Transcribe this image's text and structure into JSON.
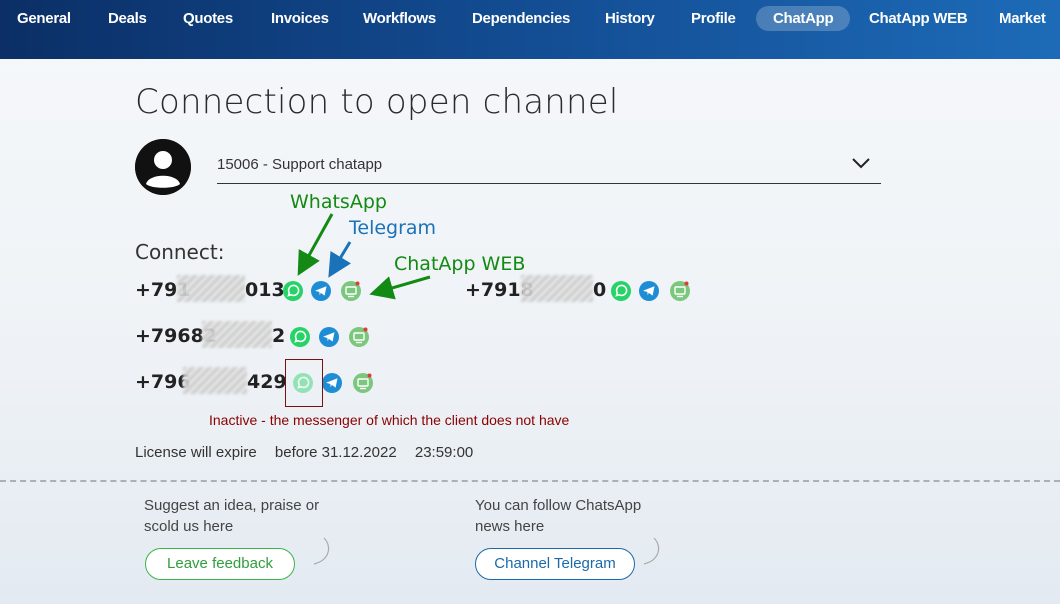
{
  "nav": {
    "tabs": [
      {
        "label": "General"
      },
      {
        "label": "Deals"
      },
      {
        "label": "Quotes"
      },
      {
        "label": "Invoices"
      },
      {
        "label": "Workflows"
      },
      {
        "label": "Dependencies"
      },
      {
        "label": "History"
      },
      {
        "label": "Profile"
      },
      {
        "label": "ChatApp",
        "active": true
      },
      {
        "label": "ChatApp WEB"
      },
      {
        "label": "Market"
      }
    ]
  },
  "page": {
    "title": "Connection to open channel",
    "channel_select": {
      "value": "15006 - Support chatapp"
    },
    "connect_label": "Connect:"
  },
  "phones": [
    {
      "prefix": "+791",
      "suffix": "013",
      "icons": [
        "whatsapp-icon",
        "telegram-icon",
        "chatapp-web-icon"
      ]
    },
    {
      "prefix": "+7918",
      "suffix": "0",
      "icons": [
        "whatsapp-icon",
        "telegram-icon",
        "chatapp-web-icon"
      ]
    },
    {
      "prefix": "+79682",
      "suffix": "2",
      "icons": [
        "whatsapp-icon",
        "telegram-icon",
        "chatapp-web-icon"
      ]
    },
    {
      "prefix": "+796",
      "suffix": "429",
      "icons": [
        "whatsapp-icon",
        "telegram-icon",
        "chatapp-web-icon"
      ],
      "whatsapp_inactive": true
    }
  ],
  "annotations": {
    "whatsapp": "WhatsApp",
    "telegram": "Telegram",
    "chatapp_web": "ChatApp WEB",
    "inactive_note": "Inactive - the messenger of which the client does not have"
  },
  "license": {
    "label": "License will expire",
    "date": "before 31.12.2022",
    "time": "23:59:00"
  },
  "footer": {
    "feedback_text_line1": "Suggest an idea, praise or",
    "feedback_text_line2": "scold us here",
    "feedback_button": "Leave feedback",
    "news_text_line1": "You can follow ChatsApp",
    "news_text_line2": "news here",
    "news_button": "Channel Telegram"
  },
  "colors": {
    "whatsapp": "#25d366",
    "telegram": "#1f8dd6",
    "chatapp_web": "#7cc77e",
    "nav_dark": "#0b2f66",
    "annotation_green": "#138a13",
    "annotation_blue": "#1a73b8",
    "inactive_red": "#8b0000"
  }
}
